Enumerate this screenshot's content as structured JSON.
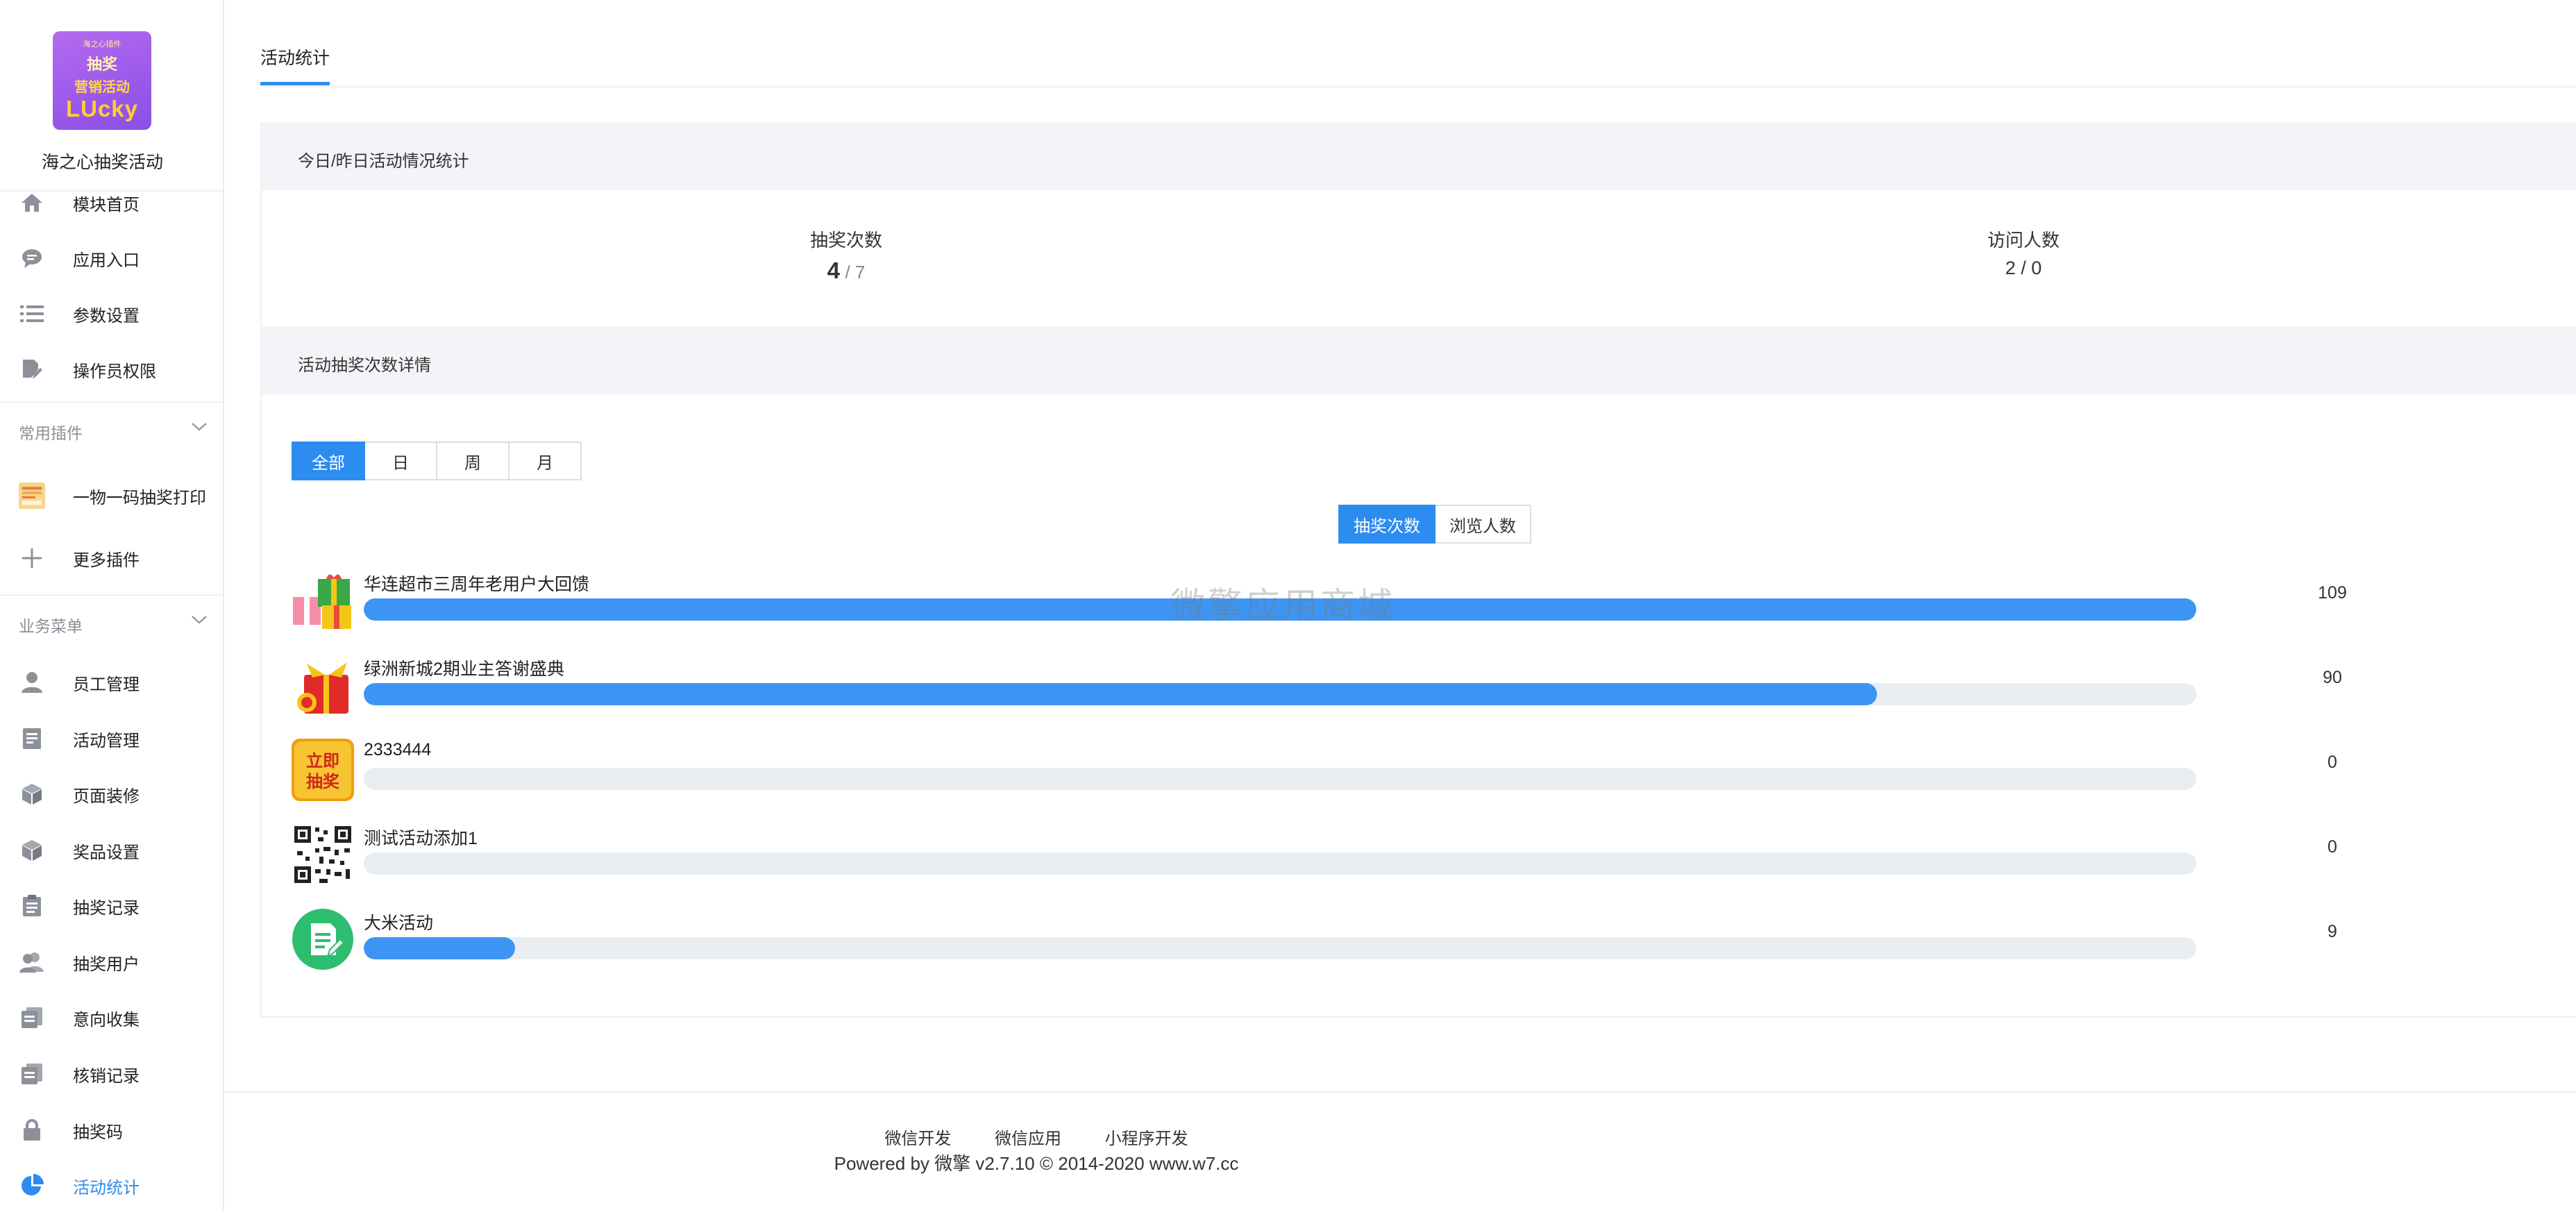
{
  "sidebar": {
    "logo": {
      "line0": "海之心插件",
      "line1": "抽奖",
      "line2": "营销活动",
      "line3": "LUcky"
    },
    "app_name": "海之心抽奖活动",
    "top_items": [
      {
        "label": "模块首页",
        "icon": "home-icon"
      },
      {
        "label": "应用入口",
        "icon": "chat-bubble-icon"
      },
      {
        "label": "参数设置",
        "icon": "list-icon"
      },
      {
        "label": "操作员权限",
        "icon": "edit-document-icon"
      }
    ],
    "group_plugins": {
      "label": "常用插件",
      "items": [
        {
          "label": "一物一码抽奖打印",
          "icon": "plugin-thumbnail-icon"
        },
        {
          "label": "更多插件",
          "icon": "plus-icon"
        }
      ]
    },
    "group_business": {
      "label": "业务菜单",
      "items": [
        {
          "label": "员工管理",
          "icon": "user-icon"
        },
        {
          "label": "活动管理",
          "icon": "document-icon"
        },
        {
          "label": "页面装修",
          "icon": "cube-icon"
        },
        {
          "label": "奖品设置",
          "icon": "cube-icon"
        },
        {
          "label": "抽奖记录",
          "icon": "clipboard-icon"
        },
        {
          "label": "抽奖用户",
          "icon": "users-icon"
        },
        {
          "label": "意向收集",
          "icon": "files-icon"
        },
        {
          "label": "核销记录",
          "icon": "files-icon"
        },
        {
          "label": "抽奖码",
          "icon": "lock-icon"
        },
        {
          "label": "活动统计",
          "icon": "pie-chart-icon",
          "active": true
        }
      ]
    }
  },
  "main": {
    "tab": "活动统计",
    "today_card": {
      "title": "今日/昨日活动情况统计",
      "draws": {
        "label": "抽奖次数",
        "today": "4",
        "yesterday": "/ 7"
      },
      "visitors": {
        "label": "访问人数",
        "value": "2 / 0"
      }
    },
    "detail_card": {
      "title": "活动抽奖次数详情",
      "range_buttons": [
        "全部",
        "日",
        "周",
        "月"
      ],
      "range_selected": "全部",
      "metric_buttons": [
        "抽奖次数",
        "浏览人数"
      ],
      "metric_selected": "抽奖次数",
      "max_value": 109,
      "rows": [
        {
          "name": "华连超市三周年老用户大回馈",
          "value": 109,
          "thumb": "gift-box-icon"
        },
        {
          "name": "绿洲新城2期业主答谢盛典",
          "value": 90,
          "thumb": "red-gift-icon"
        },
        {
          "name": "2333444",
          "value": 0,
          "thumb": "draw-now-badge-icon",
          "thumb_text": "立即抽奖"
        },
        {
          "name": "测试活动添加1",
          "value": 0,
          "thumb": "qr-code-icon"
        },
        {
          "name": "大米活动",
          "value": 9,
          "thumb": "green-document-icon"
        }
      ]
    },
    "watermark": "微擎应用商城"
  },
  "footer": {
    "links": [
      "微信开发",
      "微信应用",
      "小程序开发"
    ],
    "powered": "Powered by 微擎 v2.7.10 © 2014-2020 www.w7.cc"
  },
  "colors": {
    "accent": "#2d8cf0",
    "bar_fill": "#3d95f3",
    "bar_track": "#eaedf2",
    "card_head_bg": "#f3f4f7"
  }
}
